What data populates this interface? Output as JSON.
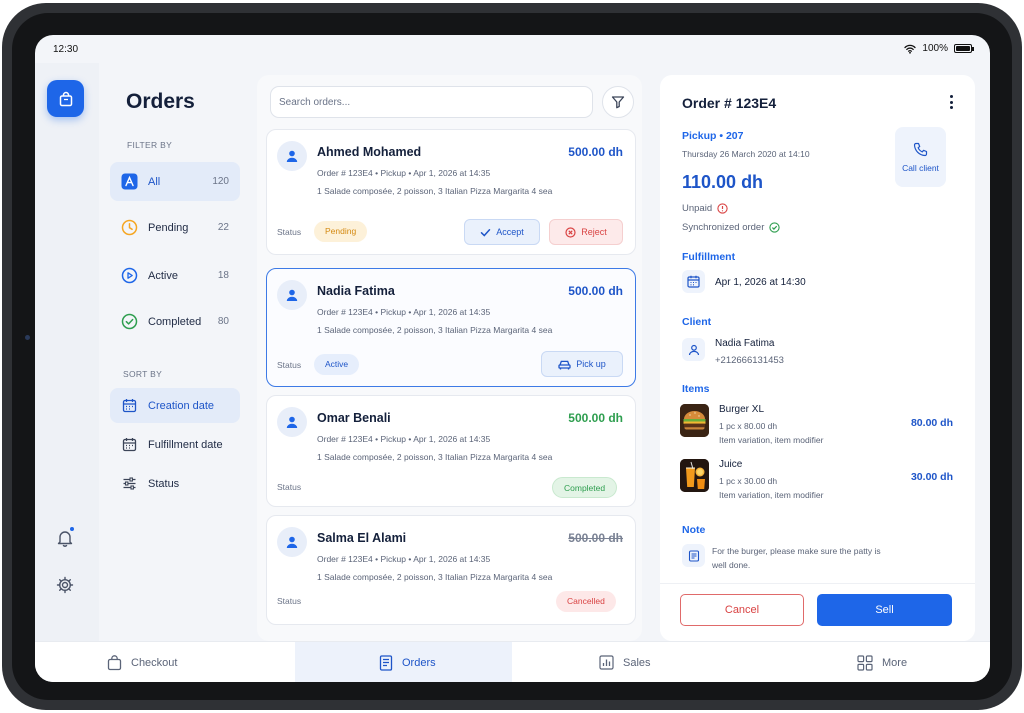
{
  "status_bar": {
    "time": "12:30",
    "battery": "100%"
  },
  "rail": {
    "app_icon": "shopping-bag-icon",
    "bell_icon": "bell-icon",
    "gear_icon": "gear-icon"
  },
  "filters": {
    "title": "Orders",
    "filter_by_label": "FILTER BY",
    "items": [
      {
        "label": "All",
        "count": "120",
        "icon": "all-icon"
      },
      {
        "label": "Pending",
        "count": "22",
        "icon": "clock-icon"
      },
      {
        "label": "Active",
        "count": "18",
        "icon": "play-circle-icon"
      },
      {
        "label": "Completed",
        "count": "80",
        "icon": "check-circle-icon"
      }
    ],
    "sort_by_label": "SORT BY",
    "sort_items": [
      {
        "label": "Creation date",
        "icon": "calendar-icon"
      },
      {
        "label": "Fulfillment date",
        "icon": "calendar-icon"
      },
      {
        "label": "Status",
        "icon": "sliders-icon"
      }
    ]
  },
  "list": {
    "search_placeholder": "Search orders...",
    "status_label": "Status",
    "orders": [
      {
        "name": "Ahmed Mohamed",
        "price": "500.00 dh",
        "order_no": "Order # 123E4",
        "type": "Pickup",
        "date": "Apr 1, 2026 at 14:35",
        "items": "1 Salade composée, 2 poisson, 3 Italian Pizza Margarita 4 sea",
        "status": "Pending",
        "accept_label": "Accept",
        "reject_label": "Reject"
      },
      {
        "name": "Nadia Fatima",
        "price": "500.00 dh",
        "order_no": "Order # 123E4",
        "type": "Pickup",
        "date": "Apr 1, 2026 at 14:35",
        "items": "1 Salade composée, 2 poisson, 3 Italian Pizza Margarita 4 sea",
        "status": "Active",
        "action_label": "Pick up"
      },
      {
        "name": "Omar Benali",
        "price": "500.00 dh",
        "order_no": "Order # 123E4",
        "type": "Pickup",
        "date": "Apr 1, 2026 at 14:35",
        "items": "1 Salade composée, 2 poisson, 3 Italian Pizza Margarita 4 sea",
        "status": "Completed"
      },
      {
        "name": "Salma El Alami",
        "price": "500.00 dh",
        "order_no": "Order # 123E4",
        "type": "Pickup",
        "date": "Apr 1, 2026 at 14:35",
        "items": "1 Salade composée, 2 poisson, 3 Italian Pizza Margarita 4 sea",
        "status": "Cancelled"
      }
    ]
  },
  "detail": {
    "title": "Order # 123E4",
    "pickup": "Pickup • 207",
    "date": "Thursday 26 March 2020 at 14:10",
    "call_label": "Call client",
    "amount": "110.00 dh",
    "payment_status": "Unpaid",
    "sync_status": "Synchronized order",
    "fulfillment_label": "Fulfillment",
    "fulfillment_date": "Apr 1, 2026 at 14:30",
    "client_label": "Client",
    "client_name": "Nadia Fatima",
    "client_phone": "+212666131453",
    "items_label": "Items",
    "items": [
      {
        "name": "Burger XL",
        "qty": "1 pc x 80.00 dh",
        "variation": "Item variation, item modifier",
        "price": "80.00 dh"
      },
      {
        "name": "Juice",
        "qty": "1 pc x 30.00 dh",
        "variation": "Item variation, item modifier",
        "price": "30.00 dh"
      }
    ],
    "note_label": "Note",
    "note_line1": "For the burger, please make sure the patty is",
    "note_line2": "well done.",
    "cancel_label": "Cancel",
    "sell_label": "Sell"
  },
  "bottom_nav": [
    {
      "label": "Checkout",
      "icon": "bag-icon"
    },
    {
      "label": "Orders",
      "icon": "receipt-icon"
    },
    {
      "label": "Sales",
      "icon": "chart-icon"
    },
    {
      "label": "More",
      "icon": "grid-icon"
    }
  ],
  "colors": {
    "accent": "#1e66e8",
    "pending": "#f5a623",
    "completed": "#2e9e4f",
    "cancelled": "#d94343"
  }
}
